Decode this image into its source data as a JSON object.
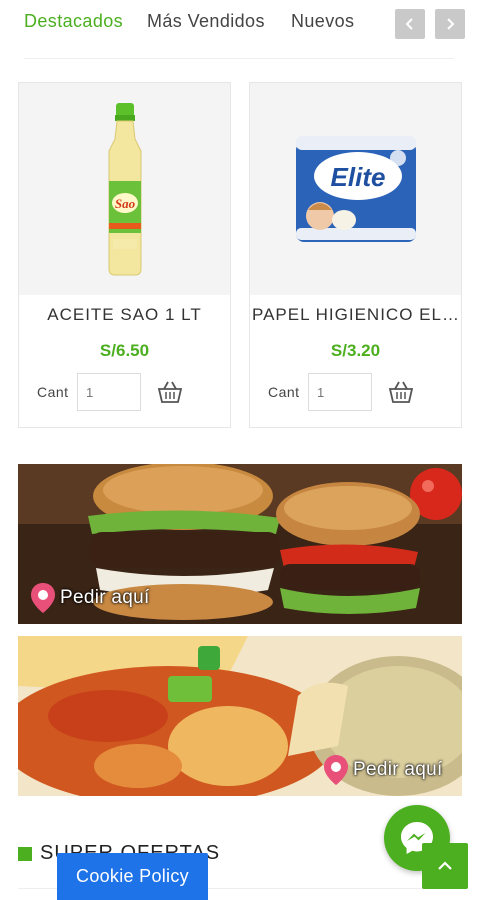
{
  "tabs": [
    {
      "label": "Destacados",
      "active": true
    },
    {
      "label": "Más Vendidos",
      "active": false
    },
    {
      "label": "Nuevos",
      "active": false
    }
  ],
  "carousel": {
    "prev_icon": "chevron-left-icon",
    "next_icon": "chevron-right-icon"
  },
  "products": [
    {
      "name": "ACEITE SAO 1 LT",
      "price": "S/6.50",
      "qty_label": "Cant",
      "qty_value": "1",
      "image_brand": "Sao"
    },
    {
      "name": "PAPEL HIGIENICO ELITE",
      "price": "S/3.20",
      "qty_label": "Cant",
      "qty_value": "1",
      "image_brand": "Elite"
    }
  ],
  "banners": [
    {
      "cta": "Pedir aquí",
      "icon": "map-pin-icon",
      "theme": "burgers"
    },
    {
      "cta": "Pedir aquí",
      "icon": "map-pin-icon",
      "theme": "chifa"
    }
  ],
  "section": {
    "title": "SUPER OFERTAS"
  },
  "cookie": {
    "label": "Cookie Policy"
  },
  "colors": {
    "accent": "#4caf1f",
    "cookie": "#1e73e8",
    "nav_button": "#c9c9c9"
  },
  "floating": {
    "messenger_icon": "messenger-icon",
    "scroll_top_icon": "chevron-up-icon"
  }
}
